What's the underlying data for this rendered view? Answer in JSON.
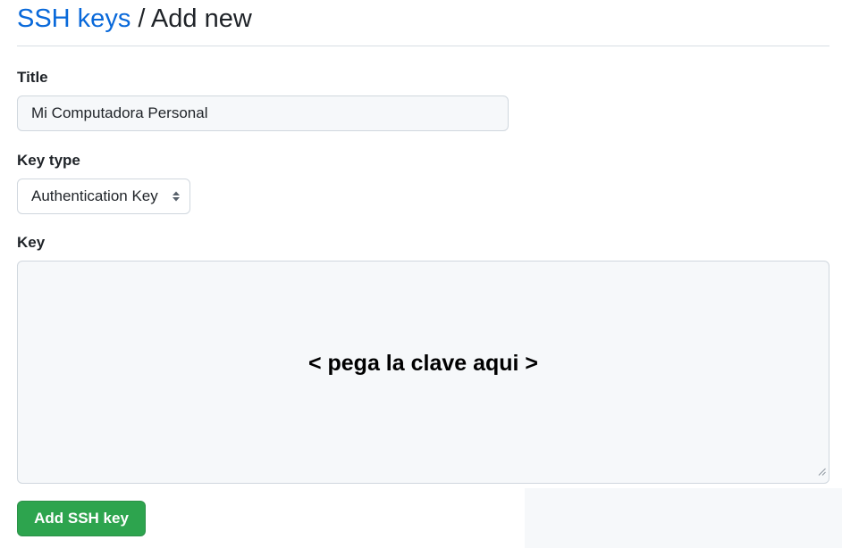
{
  "header": {
    "link": "SSH keys",
    "separator": " / ",
    "current": "Add new"
  },
  "form": {
    "title_label": "Title",
    "title_value": "Mi Computadora Personal",
    "key_type_label": "Key type",
    "key_type_value": "Authentication Key",
    "key_label": "Key",
    "key_placeholder": "< pega la clave aqui >",
    "submit_label": "Add SSH key"
  },
  "colors": {
    "link": "#0969da",
    "button": "#2da44e",
    "field_bg": "#f6f8fa",
    "border": "#d0d7de"
  },
  "icons": {
    "select": "select-arrows-icon",
    "resize": "resize-grip-icon"
  }
}
